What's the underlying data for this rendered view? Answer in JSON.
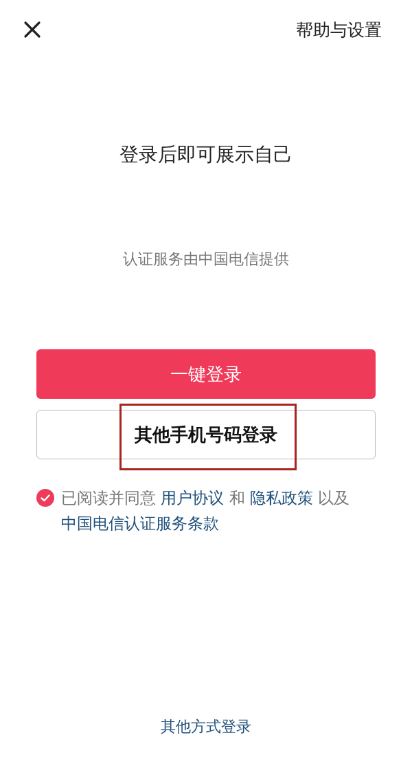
{
  "header": {
    "help_link": "帮助与设置"
  },
  "title": "登录后即可展示自己",
  "provider_note": "认证服务由中国电信提供",
  "buttons": [
    {
      "kind": "primary",
      "label": "一键登录",
      "highlighted": false
    },
    {
      "kind": "outline",
      "label": "其他手机号码登录",
      "highlighted": true
    }
  ],
  "agreement": {
    "checked": true,
    "parts": [
      {
        "kind": "text",
        "text": "已阅读并同意 "
      },
      {
        "kind": "link",
        "text": "用户协议"
      },
      {
        "kind": "text",
        "text": " 和 "
      },
      {
        "kind": "link",
        "text": "隐私政策"
      },
      {
        "kind": "text",
        "text": " 以及 "
      },
      {
        "kind": "link",
        "text": "中国电信认证服务条款"
      }
    ]
  },
  "footer": {
    "other_login": "其他方式登录"
  }
}
